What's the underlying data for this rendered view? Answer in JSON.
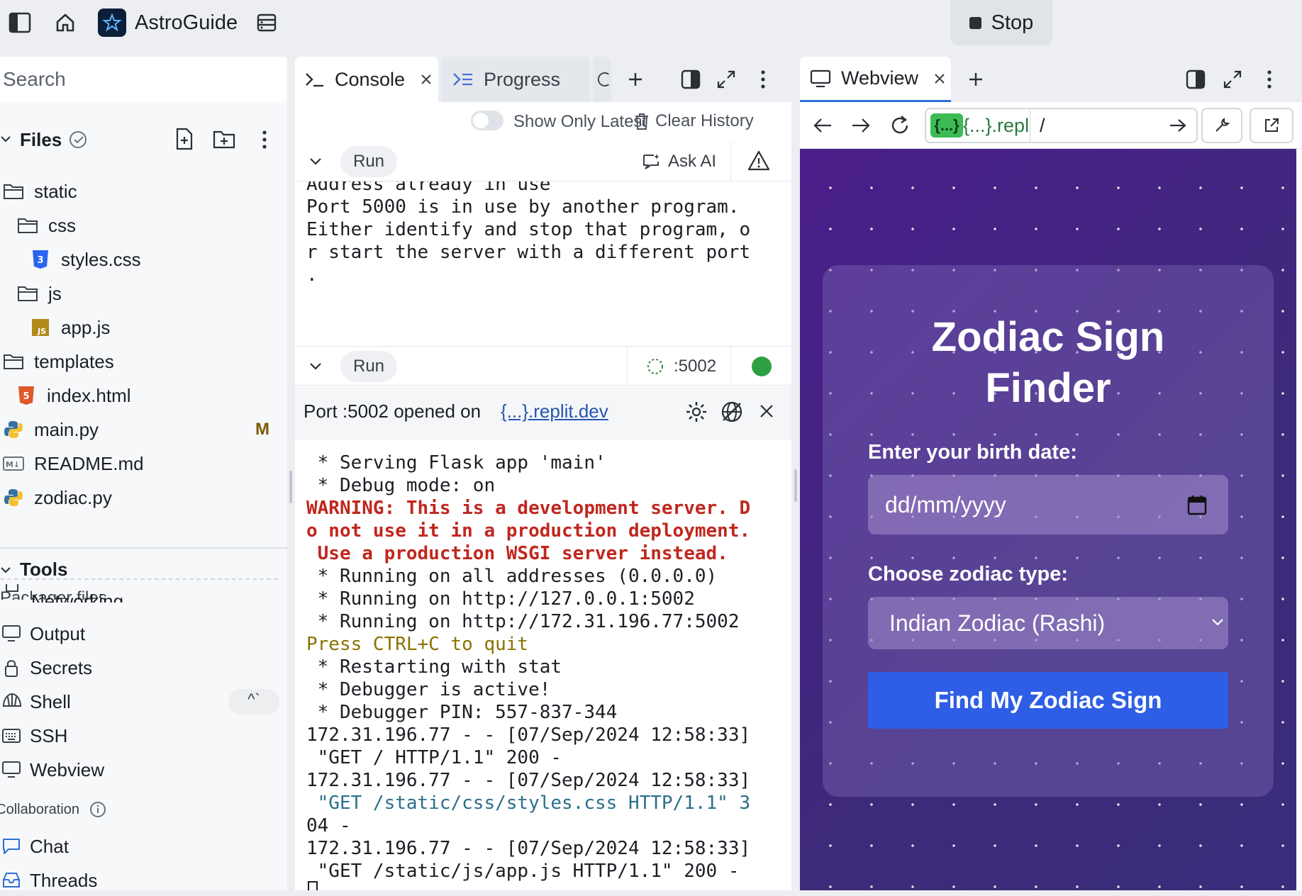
{
  "topbar": {
    "app_name": "AstroGuide",
    "stop_label": "Stop"
  },
  "sidebar": {
    "search_placeholder": "Search",
    "files_header": "Files",
    "files": [
      {
        "name": "static",
        "type": "folder"
      },
      {
        "name": "css",
        "type": "folder"
      },
      {
        "name": "styles.css",
        "type": "css"
      },
      {
        "name": "js",
        "type": "folder"
      },
      {
        "name": "app.js",
        "type": "js"
      },
      {
        "name": "templates",
        "type": "folder"
      },
      {
        "name": "index.html",
        "type": "html"
      },
      {
        "name": "main.py",
        "type": "python",
        "badge": "M"
      },
      {
        "name": "README.md",
        "type": "markdown"
      },
      {
        "name": "zodiac.py",
        "type": "python"
      }
    ],
    "packager_files_label": "Packager files",
    "tools_header": "Tools",
    "tools": [
      "Networking",
      "Output",
      "Secrets",
      "Shell",
      "SSH",
      "Webview"
    ],
    "shell_shortcut": "^`",
    "collaboration_header": "Collaboration",
    "collab_items": [
      "Chat",
      "Threads"
    ]
  },
  "console": {
    "tabs": [
      "Console",
      "Progress"
    ],
    "show_only_latest": "Show Only Latest",
    "clear_history": "Clear History",
    "run1_label": "Run",
    "ask_ai": "Ask AI",
    "run1_output": [
      {
        "text": "Address already in use",
        "color": "default"
      },
      {
        "text": "Port 5000 is in use by another program.",
        "color": "default"
      },
      {
        "text": "Either identify and stop that program, o",
        "color": "default"
      },
      {
        "text": "r start the server with a different port",
        "color": "default"
      },
      {
        "text": ".",
        "color": "default"
      }
    ],
    "run2_label": "Run",
    "port_label": ":5002",
    "port_opened_text": "Port :5002 opened on",
    "port_link": "{...}.replit.dev",
    "run2_output": [
      {
        "text": " * Serving Flask app 'main'",
        "color": "default"
      },
      {
        "text": " * Debug mode: on",
        "color": "default"
      },
      {
        "text": "WARNING: This is a development server. D",
        "color": "red"
      },
      {
        "text": "o not use it in a production deployment.",
        "color": "red"
      },
      {
        "text": " Use a production WSGI server instead.",
        "color": "red"
      },
      {
        "text": " * Running on all addresses (0.0.0.0)",
        "color": "default"
      },
      {
        "text": " * Running on http://127.0.0.1:5002",
        "color": "default"
      },
      {
        "text": " * Running on http://172.31.196.77:5002",
        "color": "default"
      },
      {
        "text": "Press CTRL+C to quit",
        "color": "olive"
      },
      {
        "text": " * Restarting with stat",
        "color": "default"
      },
      {
        "text": " * Debugger is active!",
        "color": "default"
      },
      {
        "text": " * Debugger PIN: 557-837-344",
        "color": "default"
      },
      {
        "text": "172.31.196.77 - - [07/Sep/2024 12:58:33]",
        "color": "default"
      },
      {
        "text": " \"GET / HTTP/1.1\" 200 -",
        "color": "default"
      },
      {
        "text": "172.31.196.77 - - [07/Sep/2024 12:58:33]",
        "color": "default"
      },
      {
        "text": " \"GET /static/css/styles.css HTTP/1.1\" 3",
        "color": "teal"
      },
      {
        "text": "04 -",
        "color": "default"
      },
      {
        "text": "172.31.196.77 - - [07/Sep/2024 12:58:33]",
        "color": "default"
      },
      {
        "text": " \"GET /static/js/app.js HTTP/1.1\" 200 -",
        "color": "default"
      }
    ]
  },
  "webview": {
    "tab_label": "Webview",
    "url_host": "{...}.replit.d",
    "url_path": "/",
    "page": {
      "title_line1": "Zodiac Sign",
      "title_line2": "Finder",
      "birth_label": "Enter your birth date:",
      "birth_placeholder": "dd/mm/yyyy",
      "type_label": "Choose zodiac type:",
      "type_selected": "Indian Zodiac (Rashi)",
      "submit_label": "Find My Zodiac Sign"
    }
  },
  "colors": {
    "accent_blue": "#2e5ee6",
    "warning_red": "#c0271e",
    "olive": "#8a7200",
    "teal": "#2b6f8a",
    "status_green": "#2ea043"
  }
}
